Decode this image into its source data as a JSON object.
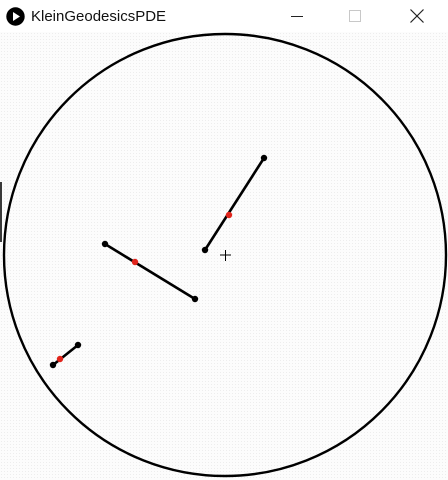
{
  "window": {
    "title": "KleinGeodesicsPDE"
  },
  "icons": {
    "app": "play-icon",
    "minimize": "minimize-icon",
    "maximize": "maximize-icon",
    "close": "close-icon",
    "cursor": "crosshair-icon"
  },
  "colors": {
    "disk_stroke": "#000000",
    "endpoint": "#000000",
    "midpoint": "#e0241b",
    "background": "#ffffff"
  },
  "segments": [
    {
      "name": "segment-1",
      "mid_color": "red"
    },
    {
      "name": "segment-2",
      "mid_color": "red"
    },
    {
      "name": "segment-3",
      "mid_color": "red"
    }
  ]
}
